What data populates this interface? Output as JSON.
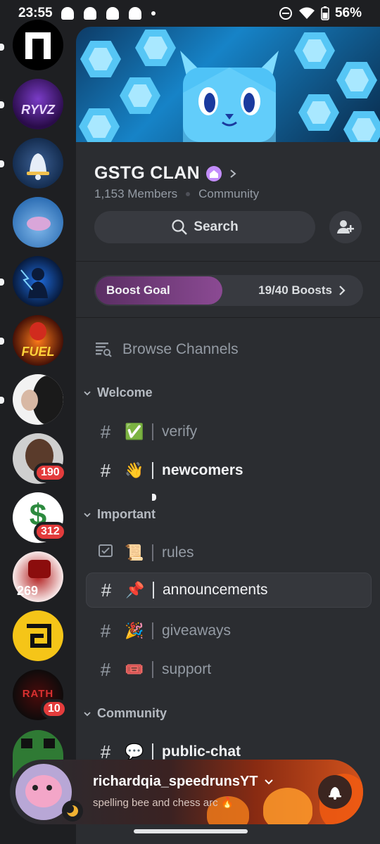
{
  "status_bar": {
    "time": "23:55",
    "battery": "56%"
  },
  "server": {
    "name": "GSTG CLAN",
    "members": "1,153 Members",
    "type": "Community",
    "search_label": "Search",
    "boost": {
      "label": "Boost Goal",
      "count": "19/40 Boosts",
      "progress": 0.475
    },
    "browse_label": "Browse Channels"
  },
  "rail": {
    "badges": {
      "drake": "190",
      "green_s": "312",
      "hc": "269",
      "rath": "10"
    },
    "texts": {
      "ryvz": "RYVZ",
      "fuel": "FUEL",
      "rath": "RATH"
    }
  },
  "categories": [
    {
      "name": "Welcome",
      "channels": [
        {
          "name": "verify",
          "emoji": "✅",
          "icon": "hash",
          "state": "normal"
        },
        {
          "name": "newcomers",
          "emoji": "👋",
          "icon": "hash",
          "state": "unread"
        }
      ]
    },
    {
      "name": "Important",
      "channels": [
        {
          "name": "rules",
          "emoji": "📜",
          "icon": "rules-checkbox",
          "state": "normal"
        },
        {
          "name": "announcements",
          "emoji": "📌",
          "icon": "hash",
          "state": "active"
        },
        {
          "name": "giveaways",
          "emoji": "🎉",
          "icon": "hash-locked",
          "state": "normal"
        },
        {
          "name": "support",
          "emoji": "🎟️",
          "icon": "hash",
          "state": "normal"
        }
      ]
    },
    {
      "name": "Community",
      "channels": [
        {
          "name": "public-chat",
          "emoji": "💬",
          "icon": "hash",
          "state": "unread"
        }
      ]
    }
  ],
  "user": {
    "name": "richardqia_speedrunsYT",
    "status": "spelling bee and chess arc 🔥"
  },
  "colors": {
    "accent_red": "#e33c3c",
    "boost_fill": "#8b4a93",
    "panel_bg": "#2b2d31",
    "rail_bg": "#1e1f22"
  }
}
